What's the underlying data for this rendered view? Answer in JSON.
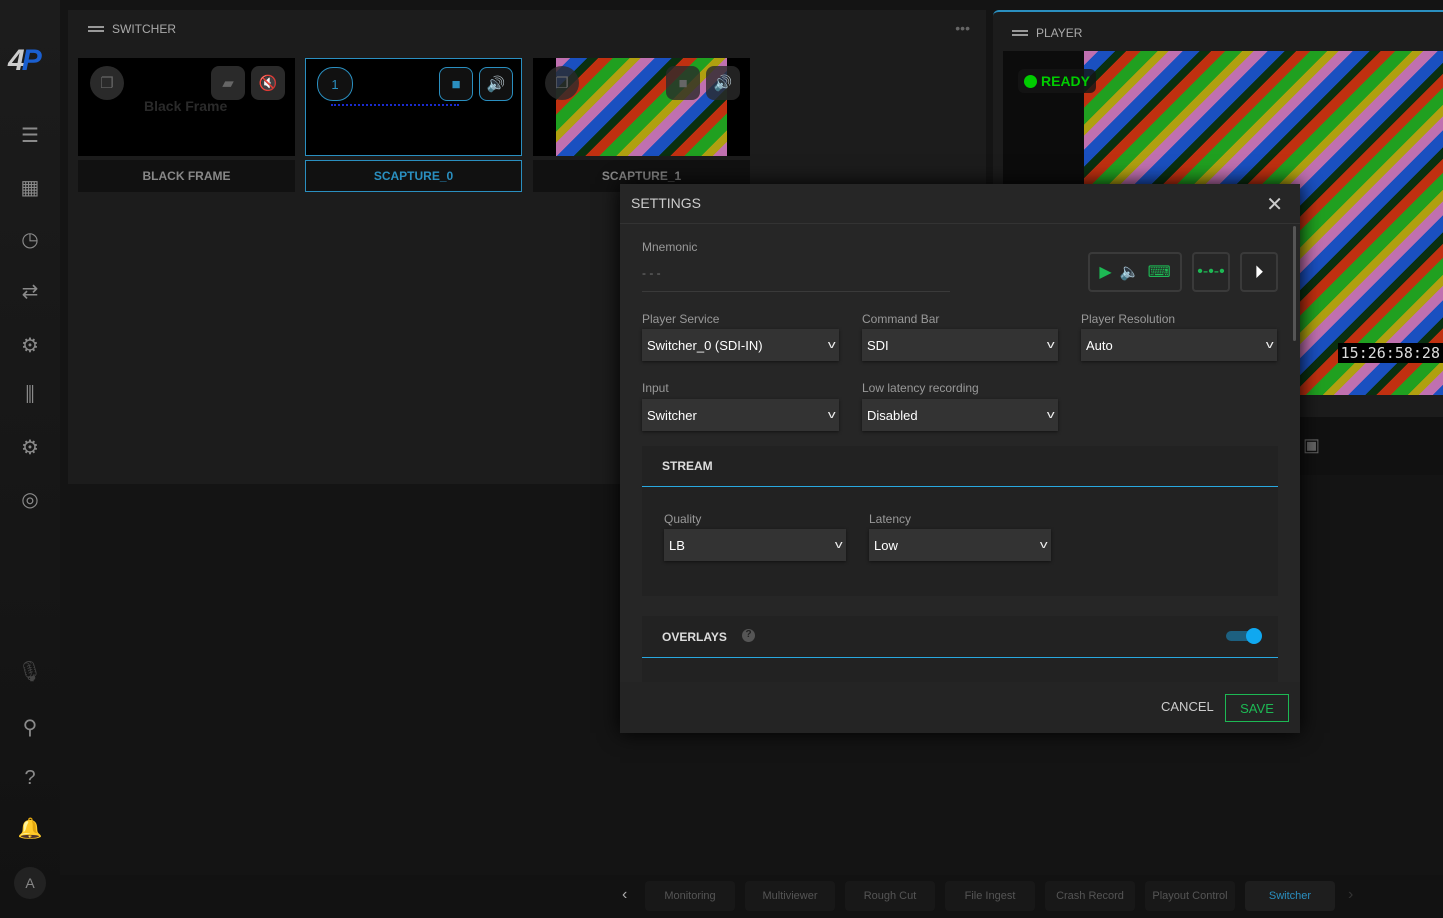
{
  "sidebar": {
    "logo": "4P",
    "avatar": "A",
    "icons": [
      "menu-icon",
      "dashboard-icon",
      "clock-icon",
      "compare-arrows-icon",
      "settings-multiple-icon",
      "mixer-icon",
      "gear-icon",
      "radar-icon",
      "mic-off-icon",
      "search-icon",
      "help-icon",
      "bell-icon"
    ]
  },
  "switcher": {
    "title": "SWITCHER",
    "tiles": [
      {
        "label": "BLACK FRAME",
        "overlay": "Black Frame"
      },
      {
        "label": "SCAPTURE_0",
        "badge": "1"
      },
      {
        "label": "SCAPTURE_1"
      }
    ]
  },
  "player": {
    "title": "PLAYER",
    "status": "READY",
    "timecode": "15:26:58:28"
  },
  "settings": {
    "title": "SETTINGS",
    "mnemonic_label": "Mnemonic",
    "mnemonic_value": "- - -",
    "player_service_label": "Player Service",
    "player_service": "Switcher_0 (SDI-IN)",
    "command_bar_label": "Command Bar",
    "command_bar": "SDI",
    "player_resolution_label": "Player Resolution",
    "player_resolution": "Auto",
    "input_label": "Input",
    "input": "Switcher",
    "low_latency_label": "Low latency recording",
    "low_latency": "Disabled",
    "stream": {
      "title": "STREAM",
      "quality_label": "Quality",
      "quality": "LB",
      "latency_label": "Latency",
      "latency": "Low"
    },
    "overlays": {
      "title": "OVERLAYS",
      "enabled": true
    },
    "cancel": "CANCEL",
    "save": "SAVE"
  },
  "bottom_tabs": {
    "items": [
      "Monitoring",
      "Multiviewer",
      "Rough Cut",
      "File Ingest",
      "Crash Record",
      "Playout Control",
      "Switcher"
    ],
    "active": "Switcher"
  },
  "colors": {
    "accent": "#2a8fc0",
    "green": "#1db954",
    "ready": "#00cc00"
  }
}
